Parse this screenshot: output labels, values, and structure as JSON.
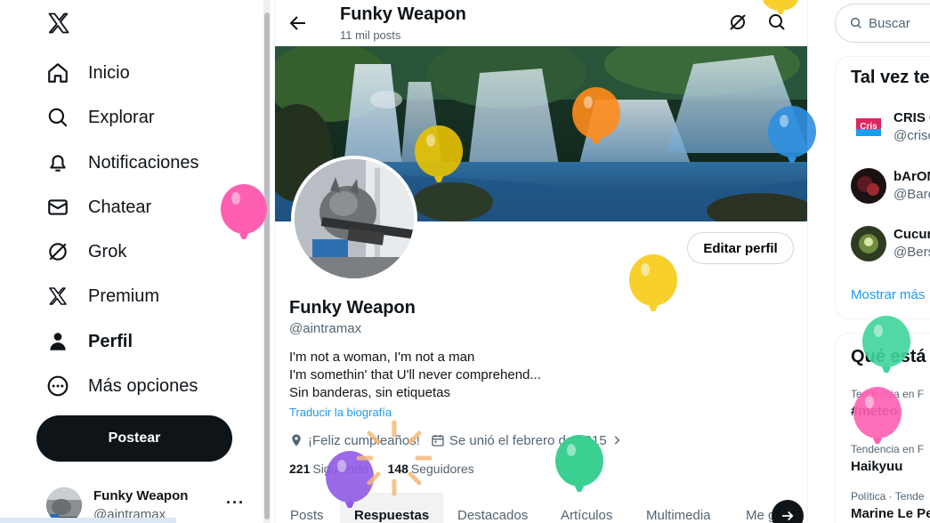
{
  "nav": {
    "items": [
      {
        "label": "Inicio",
        "icon": "home-icon"
      },
      {
        "label": "Explorar",
        "icon": "search-icon"
      },
      {
        "label": "Notificaciones",
        "icon": "bell-icon"
      },
      {
        "label": "Chatear",
        "icon": "mail-icon"
      },
      {
        "label": "Grok",
        "icon": "grok-icon"
      },
      {
        "label": "Premium",
        "icon": "x-logo-icon"
      },
      {
        "label": "Perfil",
        "icon": "person-icon"
      },
      {
        "label": "Más opciones",
        "icon": "more-circle-icon"
      }
    ],
    "post_label": "Postear",
    "account": {
      "name": "Funky Weapon",
      "handle": "@aintramax",
      "more": "···"
    }
  },
  "header": {
    "title": "Funky Weapon",
    "subtitle": "11 mil posts"
  },
  "profile": {
    "name": "Funky Weapon",
    "handle": "@aintramax",
    "edit_label": "Editar perfil",
    "bio": [
      "I'm not a woman, I'm not a man",
      "I'm somethin' that U'll never comprehend...",
      "Sin banderas, sin etiquetas"
    ],
    "translate": "Traducir la biografía",
    "birthday": "¡Feliz cumpleaños!",
    "joined": "Se unió el febrero de 2015",
    "following_count": "221",
    "following_label": "Siguiendo",
    "followers_count": "148",
    "followers_label": "Seguidores"
  },
  "tabs": [
    "Posts",
    "Respuestas",
    "Destacados",
    "Artículos",
    "Multimedia",
    "Me gusta"
  ],
  "right": {
    "search_placeholder": "Buscar",
    "suggest_title": "Tal vez te guste",
    "suggestions": [
      {
        "name": "CRIS C",
        "handle": "@crisc"
      },
      {
        "name": "bArOM",
        "handle": "@Barom"
      },
      {
        "name": "Cucur",
        "handle": "@Bers"
      }
    ],
    "show_more": "Mostrar más",
    "trends_title": "Qué está pasando",
    "trends": [
      {
        "context": "Tendencia en F",
        "name": "#meteo"
      },
      {
        "context": "Tendencia en F",
        "name": "Haikyuu"
      },
      {
        "context": "Política · Tende",
        "name": "Marine Le Pe"
      }
    ]
  },
  "colors": {
    "accent": "#1d9bf0",
    "text": "#0f1419",
    "muted": "#536471",
    "button_dark": "#0f1419"
  }
}
